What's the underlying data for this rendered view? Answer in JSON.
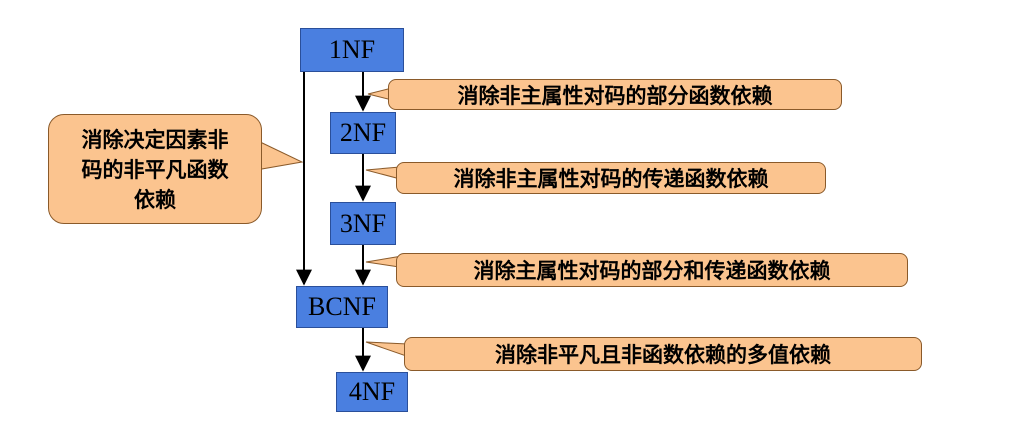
{
  "nodes": {
    "nf1": "1NF",
    "nf2": "2NF",
    "nf3": "3NF",
    "bcnf": "BCNF",
    "nf4": "4NF"
  },
  "callouts": {
    "c1": "消除非主属性对码的部分函数依赖",
    "c2": "消除非主属性对码的传递函数依赖",
    "c3": "消除主属性对码的部分和传递函数依赖",
    "c4": "消除非平凡且非函数依赖的多值依赖",
    "left": [
      "消除决定因素非",
      "码的非平凡函数",
      "依赖"
    ]
  },
  "colors": {
    "box_fill": "#4a7fe0",
    "callout_fill": "#fbc48f",
    "arrow": "#000000"
  }
}
